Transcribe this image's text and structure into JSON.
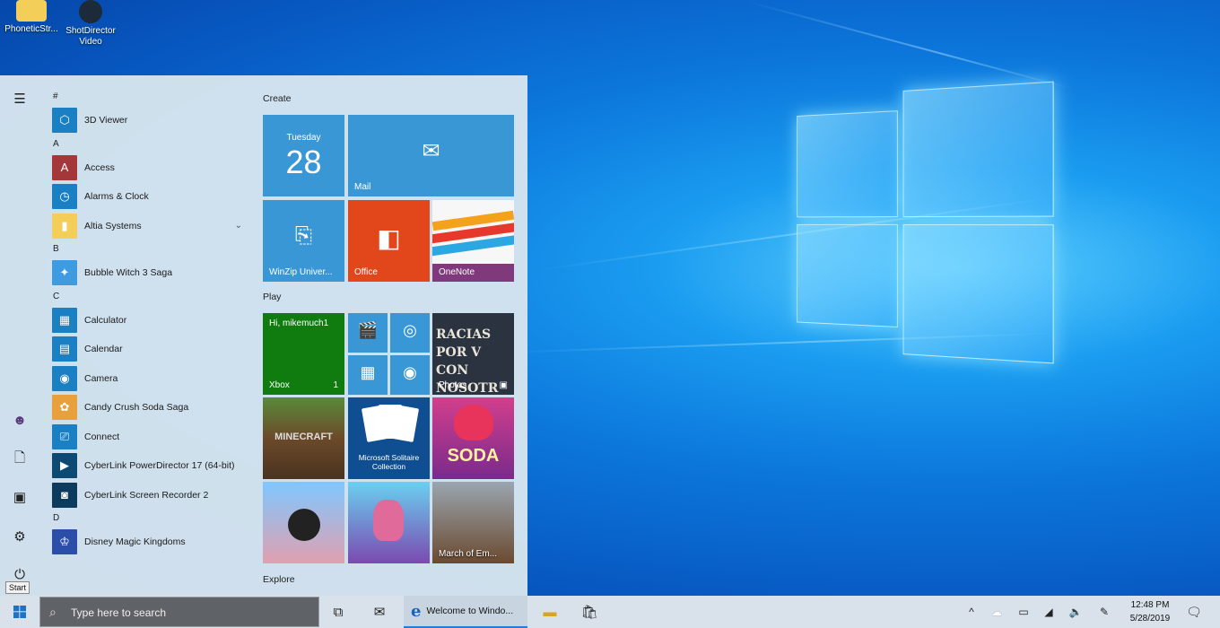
{
  "desktop": {
    "icons": [
      {
        "label": "PhoneticStr...",
        "icon": "folder-icon"
      },
      {
        "label": "ShotDirector Video",
        "icon": "video-shortcut-icon"
      }
    ]
  },
  "start_menu": {
    "rail": [
      {
        "name": "hamburger-menu-icon",
        "glyph": "☰"
      },
      {
        "name": "user-avatar-icon",
        "glyph": "☻"
      },
      {
        "name": "documents-icon",
        "glyph": "🗋"
      },
      {
        "name": "pictures-icon",
        "glyph": "▣"
      },
      {
        "name": "settings-gear-icon",
        "glyph": "⚙"
      },
      {
        "name": "power-icon",
        "glyph": "⏻"
      }
    ],
    "tooltip": "Start",
    "app_groups": [
      {
        "letter": "#",
        "apps": [
          {
            "label": "3D Viewer",
            "color": "#1b7fc4",
            "glyph": "⬡"
          }
        ]
      },
      {
        "letter": "A",
        "apps": [
          {
            "label": "Access",
            "color": "#a4373a",
            "glyph": "A"
          },
          {
            "label": "Alarms & Clock",
            "color": "#1b7fc4",
            "glyph": "◷"
          },
          {
            "label": "Altia Systems",
            "color": "#f3cf5a",
            "glyph": "▮",
            "expand": "⌄"
          }
        ]
      },
      {
        "letter": "B",
        "apps": [
          {
            "label": "Bubble Witch 3 Saga",
            "color": "#3f9be0",
            "glyph": "✦"
          }
        ]
      },
      {
        "letter": "C",
        "apps": [
          {
            "label": "Calculator",
            "color": "#1b7fc4",
            "glyph": "▦"
          },
          {
            "label": "Calendar",
            "color": "#1b7fc4",
            "glyph": "▤"
          },
          {
            "label": "Camera",
            "color": "#1b7fc4",
            "glyph": "◉"
          },
          {
            "label": "Candy Crush Soda Saga",
            "color": "#e8a03c",
            "glyph": "✿"
          },
          {
            "label": "Connect",
            "color": "#1b7fc4",
            "glyph": "⎚"
          },
          {
            "label": "CyberLink PowerDirector 17 (64-bit)",
            "color": "#0c4a74",
            "glyph": "▶"
          },
          {
            "label": "CyberLink Screen Recorder 2",
            "color": "#0c3b5e",
            "glyph": "◙"
          }
        ]
      },
      {
        "letter": "D",
        "apps": [
          {
            "label": "Disney Magic Kingdoms",
            "color": "#2b4fa8",
            "glyph": "♔"
          }
        ]
      }
    ],
    "groups": {
      "create": "Create",
      "play": "Play",
      "explore": "Explore"
    },
    "tiles": {
      "calendar": {
        "day": "Tuesday",
        "date": "28"
      },
      "mail": {
        "label": "Mail"
      },
      "winzip": {
        "label": "WinZip Univer..."
      },
      "office": {
        "label": "Office"
      },
      "onenote": {
        "label": "OneNote"
      },
      "xbox": {
        "greeting": "Hi, mikemuch1",
        "label": "Xbox",
        "count": "1"
      },
      "photos": {
        "label": "Photos",
        "banner": "RACIAS POR V CON NOSOTR"
      },
      "minecraft": {
        "label": "MINECRAFT"
      },
      "solitaire": {
        "label": "Microsoft Solitaire Collection"
      },
      "candy": {
        "label": "SODA"
      },
      "march": {
        "label": "March of Em..."
      }
    }
  },
  "taskbar": {
    "search_placeholder": "Type here to search",
    "edge_label": "Welcome to Windo...",
    "clock_time": "12:48 PM",
    "clock_date": "5/28/2019"
  }
}
